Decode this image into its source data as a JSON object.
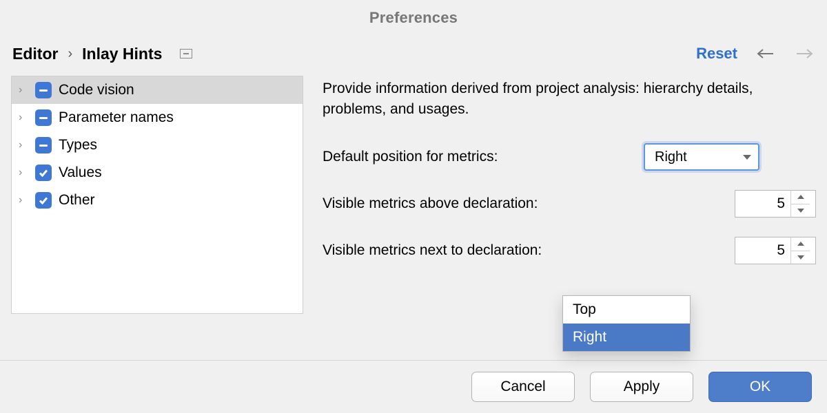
{
  "title": "Preferences",
  "breadcrumb": {
    "root": "Editor",
    "current": "Inlay Hints"
  },
  "actions": {
    "reset": "Reset"
  },
  "tree": {
    "items": [
      {
        "label": "Code vision",
        "state": "minus",
        "selected": true
      },
      {
        "label": "Parameter names",
        "state": "minus",
        "selected": false
      },
      {
        "label": "Types",
        "state": "minus",
        "selected": false
      },
      {
        "label": "Values",
        "state": "check",
        "selected": false
      },
      {
        "label": "Other",
        "state": "check",
        "selected": false
      }
    ]
  },
  "content": {
    "description": "Provide information derived from project analysis: hierarchy details, problems, and usages.",
    "default_position_label": "Default position for metrics:",
    "default_position_value": "Right",
    "default_position_options": [
      "Top",
      "Right"
    ],
    "visible_above_label": "Visible metrics above declaration:",
    "visible_above_value": "5",
    "visible_next_label": "Visible metrics next to declaration:",
    "visible_next_value": "5"
  },
  "popup": {
    "items": [
      {
        "label": "Top",
        "selected": false
      },
      {
        "label": "Right",
        "selected": true
      }
    ]
  },
  "footer": {
    "cancel": "Cancel",
    "apply": "Apply",
    "ok": "OK"
  }
}
